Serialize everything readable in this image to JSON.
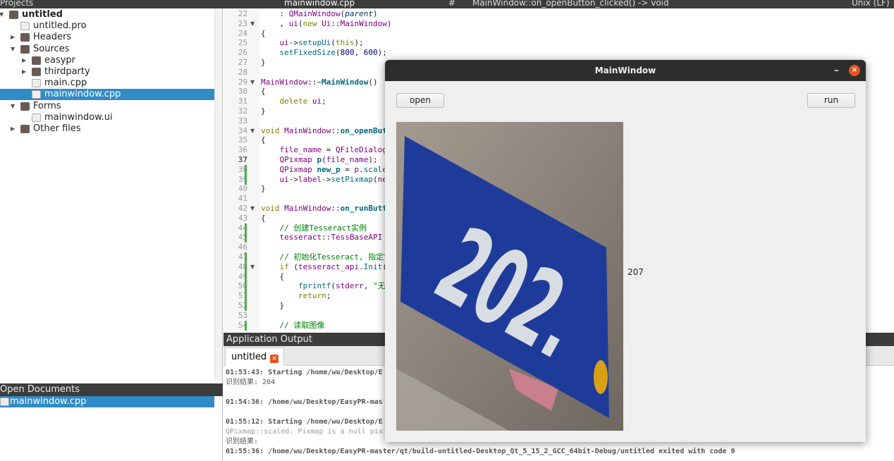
{
  "topbar": {
    "projects_title": "Projects",
    "file_tab": "mainwindow.cpp",
    "symbol": "MainWindow::on_openButton_clicked() -> void",
    "hash": "#",
    "line_ending": "Unix (LF)"
  },
  "project_tree": [
    {
      "label": "untitled",
      "depth": 0,
      "arrow": "down",
      "icon": "project-icon",
      "bold": true
    },
    {
      "label": "untitled.pro",
      "depth": 1,
      "arrow": "",
      "icon": "pro-file-icon"
    },
    {
      "label": "Headers",
      "depth": 1,
      "arrow": "right",
      "icon": "headers-folder-icon"
    },
    {
      "label": "Sources",
      "depth": 1,
      "arrow": "down",
      "icon": "sources-folder-icon"
    },
    {
      "label": "easypr",
      "depth": 2,
      "arrow": "right",
      "icon": "folder-icon"
    },
    {
      "label": "thirdparty",
      "depth": 2,
      "arrow": "right",
      "icon": "folder-icon"
    },
    {
      "label": "main.cpp",
      "depth": 2,
      "arrow": "",
      "icon": "cpp-file-icon"
    },
    {
      "label": "mainwindow.cpp",
      "depth": 2,
      "arrow": "",
      "icon": "cpp-file-icon",
      "selected": true
    },
    {
      "label": "Forms",
      "depth": 1,
      "arrow": "down",
      "icon": "forms-folder-icon"
    },
    {
      "label": "mainwindow.ui",
      "depth": 2,
      "arrow": "",
      "icon": "ui-file-icon"
    },
    {
      "label": "Other files",
      "depth": 1,
      "arrow": "right",
      "icon": "other-folder-icon"
    }
  ],
  "open_documents": {
    "title": "Open Documents",
    "items": [
      "mainwindow.cpp"
    ]
  },
  "editor": {
    "current_line": 37,
    "lines": [
      {
        "n": 22,
        "tokens": [
          [
            "    : ",
            ""
          ],
          [
            "QMainWindow",
            "t"
          ],
          [
            "(",
            ""
          ],
          [
            "parent",
            "i"
          ],
          [
            ")",
            ""
          ]
        ]
      },
      {
        "n": 23,
        "fold": true,
        "tokens": [
          [
            "    , ",
            ""
          ],
          [
            "ui",
            "t"
          ],
          [
            "(",
            ""
          ],
          [
            "new ",
            "k"
          ],
          [
            "Ui",
            "t"
          ],
          [
            "::",
            ""
          ],
          [
            "MainWindow",
            "t"
          ],
          [
            ")",
            ""
          ]
        ]
      },
      {
        "n": 24,
        "tokens": [
          [
            "{",
            ""
          ]
        ]
      },
      {
        "n": 25,
        "tokens": [
          [
            "    ",
            ""
          ],
          [
            "ui",
            "t"
          ],
          [
            "->",
            ""
          ],
          [
            "setupUi",
            "f"
          ],
          [
            "(",
            ""
          ],
          [
            "this",
            "k"
          ],
          [
            ");",
            ""
          ]
        ]
      },
      {
        "n": 26,
        "tokens": [
          [
            "    ",
            ""
          ],
          [
            "setFixedSize",
            "f"
          ],
          [
            "(",
            ""
          ],
          [
            "800",
            "n"
          ],
          [
            ", ",
            ""
          ],
          [
            "600",
            "n"
          ],
          [
            ");",
            ""
          ]
        ]
      },
      {
        "n": 27,
        "tokens": [
          [
            "}",
            ""
          ]
        ]
      },
      {
        "n": 28,
        "tokens": []
      },
      {
        "n": 29,
        "fold": true,
        "tokens": [
          [
            "MainWindow",
            "t"
          ],
          [
            "::~",
            ""
          ],
          [
            "MainWindow",
            "b"
          ],
          [
            "()",
            ""
          ]
        ]
      },
      {
        "n": 30,
        "tokens": [
          [
            "{",
            ""
          ]
        ]
      },
      {
        "n": 31,
        "tokens": [
          [
            "    ",
            ""
          ],
          [
            "delete ",
            "k"
          ],
          [
            "ui",
            "t"
          ],
          [
            ";",
            ""
          ]
        ]
      },
      {
        "n": 32,
        "tokens": [
          [
            "}",
            ""
          ]
        ]
      },
      {
        "n": 33,
        "tokens": []
      },
      {
        "n": 34,
        "fold": true,
        "tokens": [
          [
            "void ",
            "k"
          ],
          [
            "MainWindow",
            "t"
          ],
          [
            "::",
            ""
          ],
          [
            "on_openButto",
            "b"
          ]
        ]
      },
      {
        "n": 35,
        "tokens": [
          [
            "{",
            ""
          ]
        ]
      },
      {
        "n": 36,
        "tokens": [
          [
            "    ",
            ""
          ],
          [
            "file_name",
            "t"
          ],
          [
            " = ",
            ""
          ],
          [
            "QFileDialog",
            "t"
          ],
          [
            "::",
            ""
          ]
        ]
      },
      {
        "n": 37,
        "tokens": [
          [
            "    ",
            ""
          ],
          [
            "QPixmap ",
            "t"
          ],
          [
            "p",
            "b"
          ],
          [
            "(",
            ""
          ],
          [
            "file_name",
            "t"
          ],
          [
            ");",
            ""
          ]
        ]
      },
      {
        "n": 38,
        "changed": true,
        "tokens": [
          [
            "    ",
            ""
          ],
          [
            "QPixmap ",
            "t"
          ],
          [
            "new_p",
            "b"
          ],
          [
            " = ",
            ""
          ],
          [
            "p",
            "t"
          ],
          [
            ".",
            ""
          ],
          [
            "scaled",
            "f"
          ],
          [
            "(",
            ""
          ]
        ]
      },
      {
        "n": 39,
        "changed": true,
        "tokens": [
          [
            "    ",
            ""
          ],
          [
            "ui",
            "t"
          ],
          [
            "->",
            ""
          ],
          [
            "label",
            "t"
          ],
          [
            "->",
            ""
          ],
          [
            "setPixmap",
            "f"
          ],
          [
            "(",
            ""
          ],
          [
            "new_",
            "t"
          ]
        ]
      },
      {
        "n": 40,
        "tokens": [
          [
            "}",
            ""
          ]
        ]
      },
      {
        "n": 41,
        "tokens": []
      },
      {
        "n": 42,
        "fold": true,
        "tokens": [
          [
            "void ",
            "k"
          ],
          [
            "MainWindow",
            "t"
          ],
          [
            "::",
            ""
          ],
          [
            "on_runButton",
            "b"
          ]
        ]
      },
      {
        "n": 43,
        "tokens": [
          [
            "{",
            ""
          ]
        ]
      },
      {
        "n": 44,
        "changed": true,
        "tokens": [
          [
            "    // 创建Tesseract实例",
            "c"
          ]
        ]
      },
      {
        "n": 45,
        "changed": true,
        "tokens": [
          [
            "    ",
            ""
          ],
          [
            "tesseract",
            "t"
          ],
          [
            "::",
            ""
          ],
          [
            "TessBaseAPI ",
            "t"
          ],
          [
            "te",
            "b"
          ]
        ]
      },
      {
        "n": 46,
        "tokens": []
      },
      {
        "n": 47,
        "changed": true,
        "tokens": [
          [
            "    // 初始化Tesseract, 指定语言",
            "c"
          ]
        ]
      },
      {
        "n": 48,
        "changed": true,
        "fold": true,
        "tokens": [
          [
            "    ",
            ""
          ],
          [
            "if ",
            "k"
          ],
          [
            "(",
            ""
          ],
          [
            "tesseract_api",
            "t"
          ],
          [
            ".",
            ""
          ],
          [
            "Init",
            "f"
          ],
          [
            "(",
            ""
          ],
          [
            "NU",
            "t"
          ]
        ]
      },
      {
        "n": 49,
        "changed": true,
        "tokens": [
          [
            "    {",
            ""
          ]
        ]
      },
      {
        "n": 50,
        "changed": true,
        "tokens": [
          [
            "        ",
            ""
          ],
          [
            "fprintf",
            "f"
          ],
          [
            "(",
            ""
          ],
          [
            "stderr",
            "t"
          ],
          [
            ", ",
            ""
          ],
          [
            "\"无法",
            "s"
          ]
        ]
      },
      {
        "n": 51,
        "changed": true,
        "tokens": [
          [
            "        ",
            ""
          ],
          [
            "return",
            "k"
          ],
          [
            ";",
            ""
          ]
        ]
      },
      {
        "n": 52,
        "changed": true,
        "tokens": [
          [
            "    }",
            ""
          ]
        ]
      },
      {
        "n": 53,
        "tokens": []
      },
      {
        "n": 54,
        "changed": true,
        "tokens": [
          [
            "    // 读取图像",
            "c"
          ]
        ]
      }
    ]
  },
  "app_output": {
    "title": "Application Output",
    "tab": "untitled",
    "lines": [
      {
        "text": "01:53:43: Starting /home/wu/Desktop/E",
        "style": "bold"
      },
      {
        "text": "识别结果: 204",
        "style": "normal"
      },
      {
        "text": "",
        "style": "normal"
      },
      {
        "text": "01:54:36: /home/wu/Desktop/EasyPR-mas",
        "style": "bold"
      },
      {
        "text": "",
        "style": "normal"
      },
      {
        "text": "01:55:12: Starting /home/wu/Desktop/E",
        "style": "bold"
      },
      {
        "text": "QPixmap::scaled: Pixmap is a null pix",
        "style": "gray"
      },
      {
        "text": "识别结果:",
        "style": "normal"
      },
      {
        "text": "01:55:36: /home/wu/Desktop/EasyPR-master/qt/build-untitled-Desktop_Qt_5_15_2_GCC_64bit-Debug/untitled exited with code 0",
        "style": "bold"
      }
    ]
  },
  "main_window": {
    "title": "MainWindow",
    "open_label": "open",
    "run_label": "run",
    "result": "207",
    "image_sign_text": "202.",
    "colors": {
      "sign_blue": "#1f3b9a",
      "dot": "#d9a016",
      "close": "#e95420"
    }
  }
}
